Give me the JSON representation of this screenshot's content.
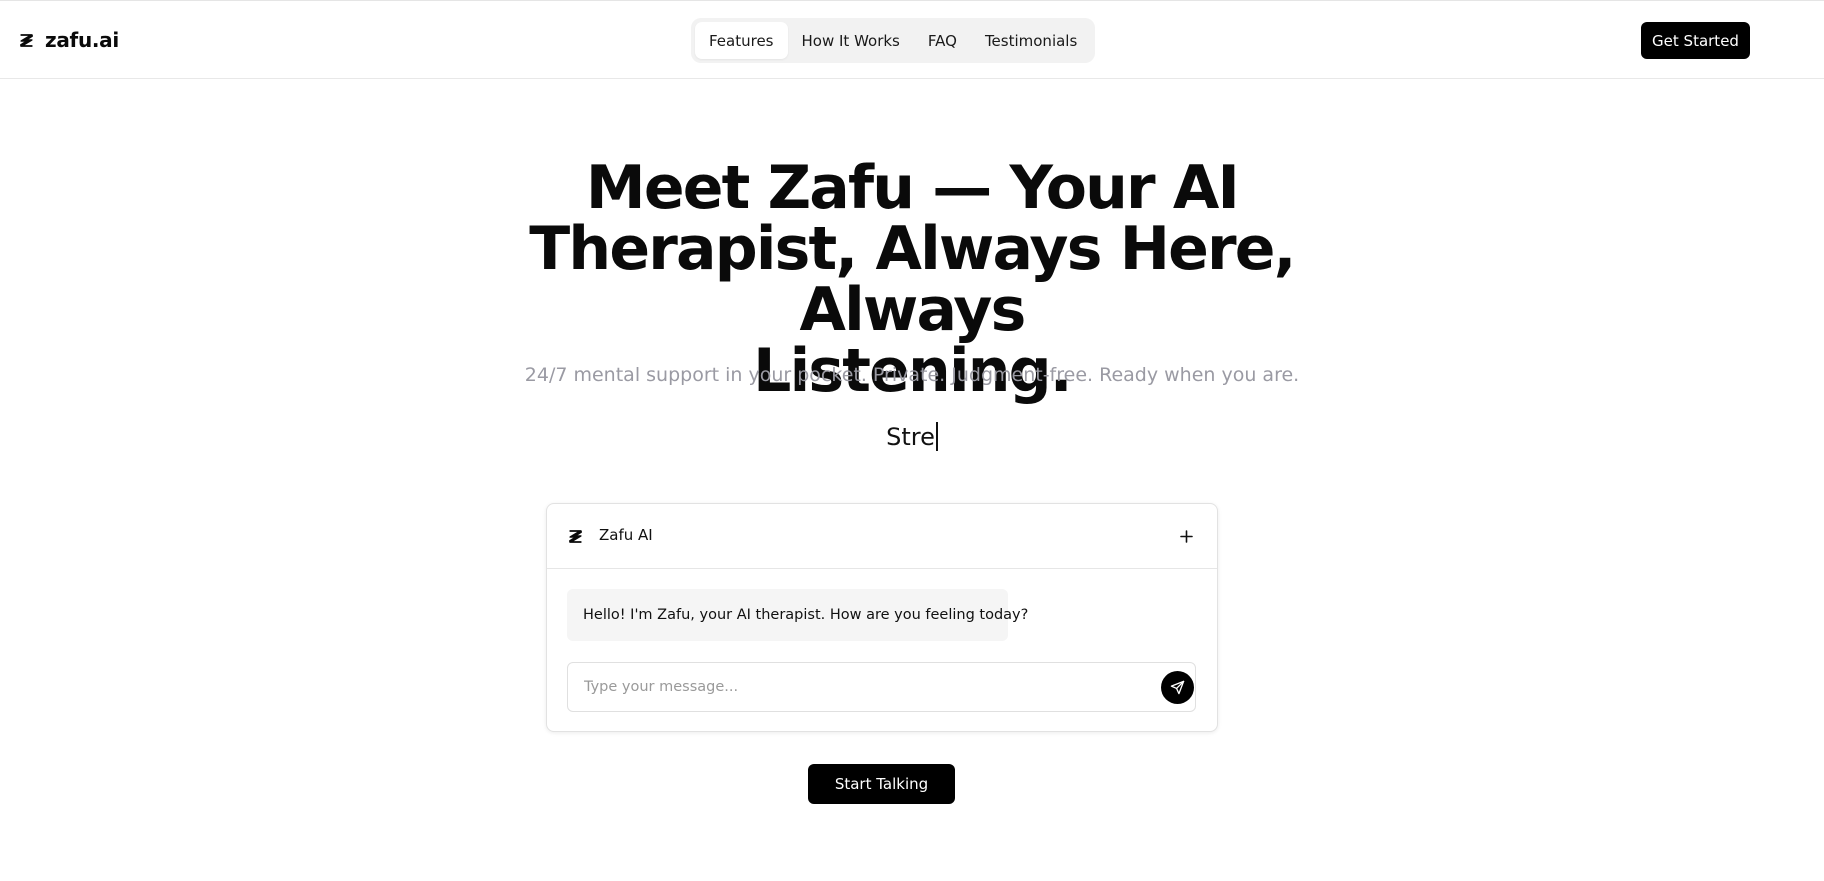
{
  "header": {
    "brand": "zafu.ai",
    "logo_icon": "zafu-logo-icon",
    "nav": [
      {
        "label": "Features",
        "active": true
      },
      {
        "label": "How It Works",
        "active": false
      },
      {
        "label": "FAQ",
        "active": false
      },
      {
        "label": "Testimonials",
        "active": false
      }
    ],
    "cta_label": "Get Started"
  },
  "hero": {
    "title_lines": [
      "Meet Zafu — Your AI",
      "Therapist, Always Here, Always",
      "Listening."
    ],
    "subtitle": "24/7 mental support in your pocket. Private. Judgment-free. Ready when you are.",
    "typing_text": "Stre"
  },
  "chat": {
    "title": "Zafu AI",
    "new_chat_icon": "plus-icon",
    "messages": [
      {
        "role": "assistant",
        "text": "Hello! I'm Zafu, your AI therapist. How are you feeling today?"
      }
    ],
    "input_placeholder": "Type your message...",
    "input_value": "",
    "send_icon": "send-icon"
  },
  "cta": {
    "start_label": "Start Talking"
  },
  "colors": {
    "primary": "#000000",
    "muted_text": "#9a9aa3",
    "nav_bg": "#f2f2f2",
    "bubble_bg": "#f5f5f5"
  }
}
